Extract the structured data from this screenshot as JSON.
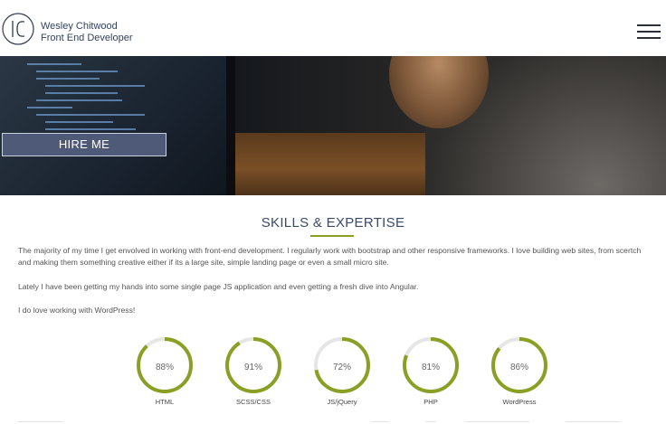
{
  "header": {
    "name": "Wesley Chitwood",
    "role": "Front End Developer",
    "logo_icon": "wc-monogram-logo",
    "menu_icon": "hamburger-menu-icon"
  },
  "hero": {
    "hire_button": "HIRE ME"
  },
  "skills": {
    "title": "SKILLS & EXPERTISE",
    "paragraphs": [
      "The majority of my time I get envolved in working with front-end development. I regularly work with bootstrap and other responsive frameworks. I love building web sites, from scertch and making them something creative either if its a large site, simple landing page or even a small micro site.",
      "Lately I have been getting my hands into some single page JS application and even getting a fresh dive into Angular.",
      "I do love working with WordPress!"
    ],
    "gauges": [
      {
        "label": "HTML",
        "value": "88%",
        "percent": 88
      },
      {
        "label": "SCSS/CSS",
        "value": "91%",
        "percent": 91
      },
      {
        "label": "JS/jQuery",
        "value": "72%",
        "percent": 72
      },
      {
        "label": "PHP",
        "value": "81%",
        "percent": 81
      },
      {
        "label": "WordPress",
        "value": "86%",
        "percent": 86
      }
    ]
  },
  "colors": {
    "accent": "#8aa024",
    "brand": "#33415c",
    "button": "#4e5a77",
    "track": "#e6e6e6"
  }
}
